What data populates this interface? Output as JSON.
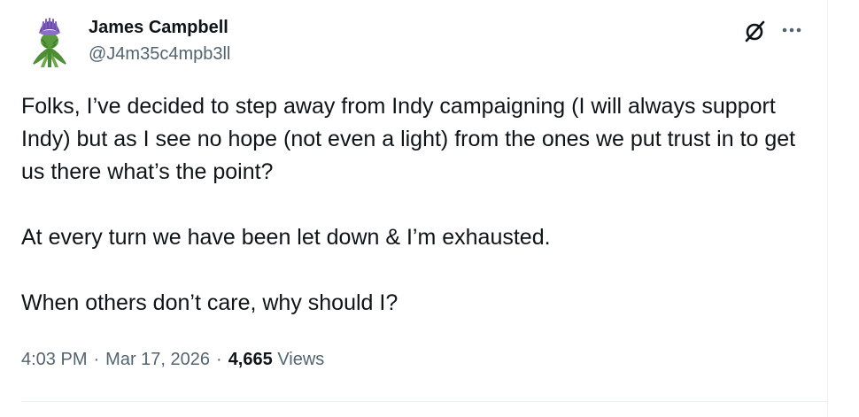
{
  "author": {
    "display_name": "James Campbell",
    "handle": "@J4m35c4mpb3ll",
    "avatar_icon": "thistle-icon"
  },
  "actions": {
    "grok_icon": "grok-slash-circle-icon",
    "more_icon": "ellipsis-icon"
  },
  "tweet": {
    "paragraphs": [
      "Folks, I’ve decided to step away from Indy campaigning (I will always support Indy) but as I see no hope (not even a light) from the ones we put trust in to get us there what’s the point?",
      "At every turn we have been let down & I’m exhausted.",
      "When others don’t care, why should I?"
    ]
  },
  "meta": {
    "time": "4:03 PM",
    "separator": "·",
    "date": "Mar 17, 2026",
    "views_count": "4,665",
    "views_label": "Views"
  },
  "colors": {
    "text_primary": "#0f1419",
    "text_secondary": "#536471",
    "divider": "#eff3f4",
    "thistle_purple": "#6d4aa8",
    "thistle_green": "#5a9a3e"
  }
}
